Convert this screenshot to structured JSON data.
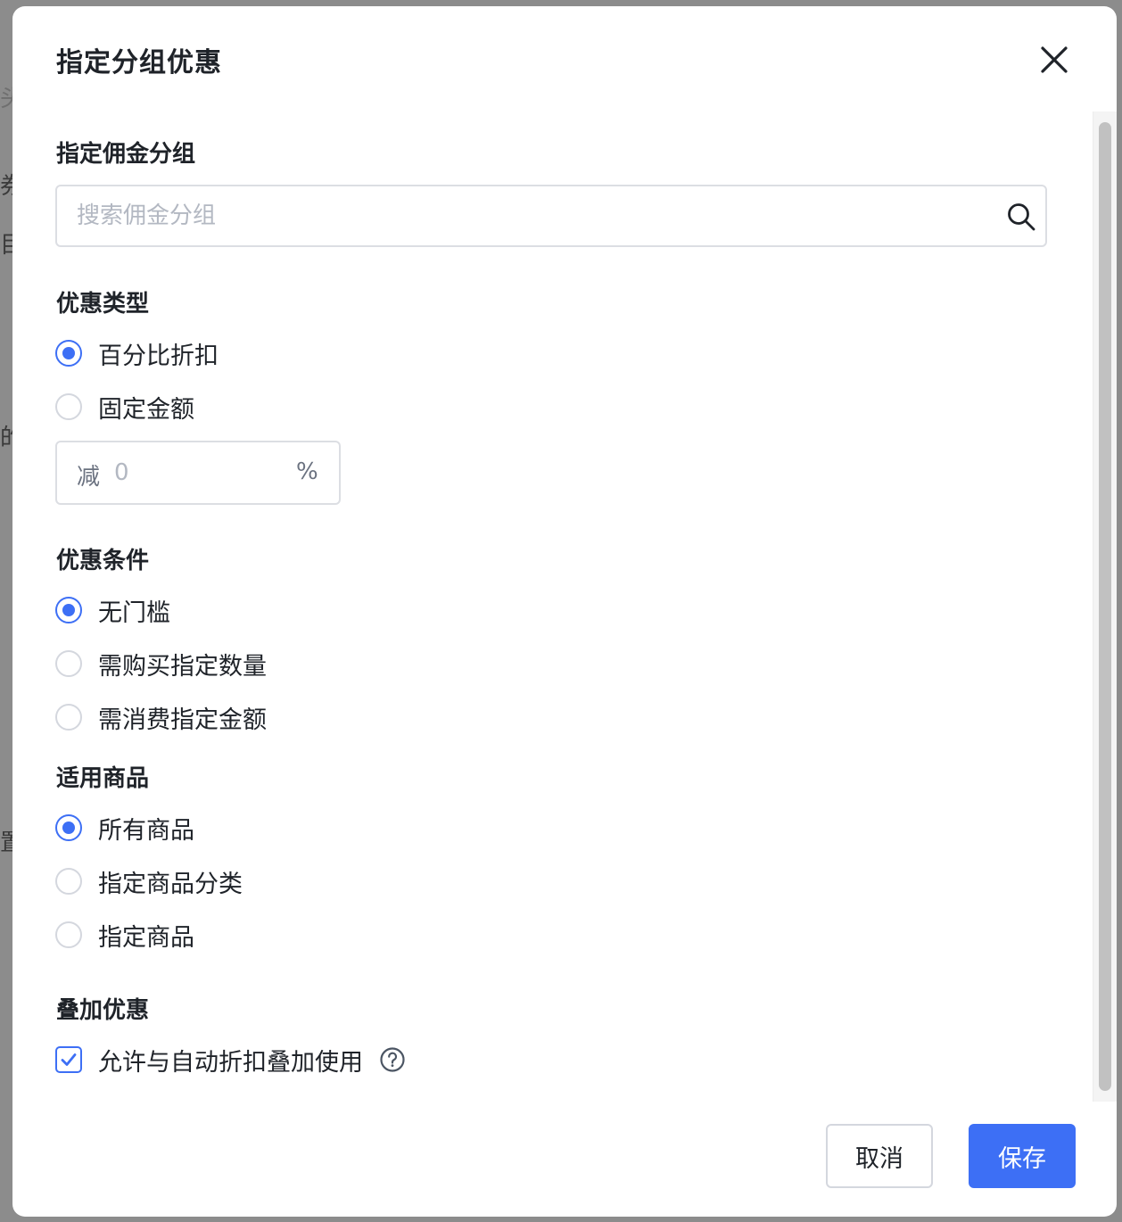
{
  "background": {
    "fragments": [
      "头",
      "券",
      "目",
      "的",
      "置"
    ]
  },
  "modal": {
    "title": "指定分组优惠"
  },
  "commission_group": {
    "label": "指定佣金分组",
    "search_placeholder": "搜索佣金分组",
    "search_value": ""
  },
  "discount_type": {
    "label": "优惠类型",
    "options": [
      {
        "label": "百分比折扣",
        "checked": true
      },
      {
        "label": "固定金额",
        "checked": false
      }
    ],
    "amount_prefix": "减",
    "amount_placeholder": "0",
    "amount_suffix": "%"
  },
  "discount_condition": {
    "label": "优惠条件",
    "options": [
      {
        "label": "无门槛",
        "checked": true
      },
      {
        "label": "需购买指定数量",
        "checked": false
      },
      {
        "label": "需消费指定金额",
        "checked": false
      }
    ]
  },
  "applicable_products": {
    "label": "适用商品",
    "options": [
      {
        "label": "所有商品",
        "checked": true
      },
      {
        "label": "指定商品分类",
        "checked": false
      },
      {
        "label": "指定商品",
        "checked": false
      }
    ]
  },
  "stacking": {
    "label": "叠加优惠",
    "checkbox_label": "允许与自动折扣叠加使用",
    "checked": true
  },
  "footer": {
    "cancel_label": "取消",
    "save_label": "保存"
  },
  "colors": {
    "primary": "#3d6ff5",
    "border": "#dcdee3",
    "text": "#1f2329",
    "placeholder": "#b3b8c2"
  },
  "icons": {
    "close": "close-icon",
    "search": "search-icon",
    "check": "check-icon",
    "help": "question-circle-icon"
  }
}
